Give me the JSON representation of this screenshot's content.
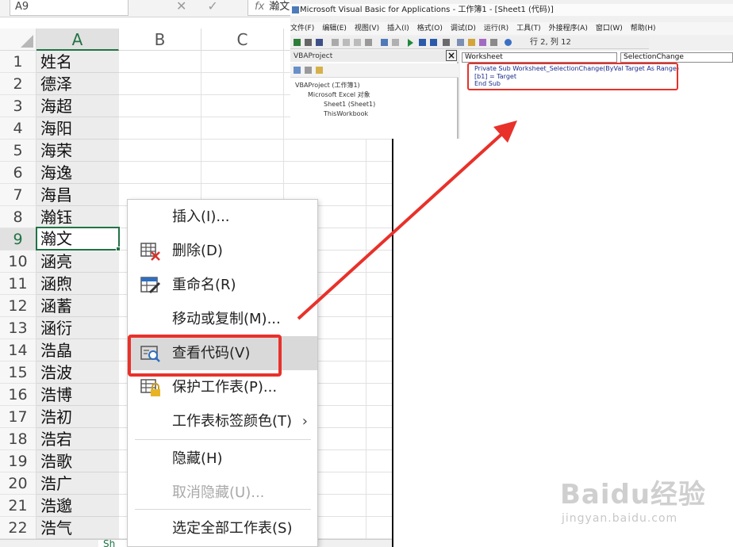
{
  "excel": {
    "name_box": "A9",
    "formula_value": "瀚文",
    "sheet_tab_label": "Sh",
    "column_headers": [
      "A",
      "B",
      "C"
    ],
    "rows": [
      {
        "num": "1",
        "a": "姓名"
      },
      {
        "num": "2",
        "a": "德泽"
      },
      {
        "num": "3",
        "a": "海超"
      },
      {
        "num": "4",
        "a": "海阳"
      },
      {
        "num": "5",
        "a": "海荣"
      },
      {
        "num": "6",
        "a": "海逸"
      },
      {
        "num": "7",
        "a": "海昌"
      },
      {
        "num": "8",
        "a": "瀚钰"
      },
      {
        "num": "9",
        "a": "瀚文"
      },
      {
        "num": "10",
        "a": "涵亮"
      },
      {
        "num": "11",
        "a": "涵煦"
      },
      {
        "num": "12",
        "a": "涵蓄"
      },
      {
        "num": "13",
        "a": "涵衍"
      },
      {
        "num": "14",
        "a": "浩皛"
      },
      {
        "num": "15",
        "a": "浩波"
      },
      {
        "num": "16",
        "a": "浩博"
      },
      {
        "num": "17",
        "a": "浩初"
      },
      {
        "num": "18",
        "a": "浩宕"
      },
      {
        "num": "19",
        "a": "浩歌"
      },
      {
        "num": "20",
        "a": "浩广"
      },
      {
        "num": "21",
        "a": "浩邈"
      },
      {
        "num": "22",
        "a": "浩气"
      }
    ]
  },
  "context_menu": {
    "items": [
      {
        "label": "插入(I)...",
        "icon": ""
      },
      {
        "label": "删除(D)",
        "icon": "delete-sheet-icon"
      },
      {
        "label": "重命名(R)",
        "icon": "rename-sheet-icon"
      },
      {
        "label": "移动或复制(M)...",
        "icon": ""
      },
      {
        "label": "查看代码(V)",
        "icon": "view-code-icon"
      },
      {
        "label": "保护工作表(P)...",
        "icon": "protect-sheet-icon"
      },
      {
        "label": "工作表标签颜色(T)",
        "icon": ""
      },
      {
        "label": "隐藏(H)",
        "icon": ""
      },
      {
        "label": "取消隐藏(U)...",
        "icon": ""
      },
      {
        "label": "选定全部工作表(S)",
        "icon": ""
      }
    ],
    "submenu_arrow": "›"
  },
  "vba": {
    "title": "Microsoft Visual Basic for Applications - 工作簿1 - [Sheet1 (代码)]",
    "menu": [
      "文件(F)",
      "编辑(E)",
      "视图(V)",
      "插入(I)",
      "格式(O)",
      "调试(D)",
      "运行(R)",
      "工具(T)",
      "外接程序(A)",
      "窗口(W)",
      "帮助(H)"
    ],
    "cursor_position": "行 2, 列 12",
    "project_title": "VBAProject",
    "tree": [
      "VBAProject (工作簿1)",
      "Microsoft Excel 对象",
      "Sheet1 (Sheet1)",
      "ThisWorkbook"
    ],
    "object_combo": "Worksheet",
    "procedure_combo": "SelectionChange",
    "code": [
      "Private Sub Worksheet_SelectionChange(ByVal Target As Range)",
      "[b1] = Target",
      "End Sub"
    ]
  },
  "watermark": {
    "brand": "Baidu经验",
    "url": "jingyan.baidu.com"
  },
  "colors": {
    "excel_green": "#217346",
    "highlight_red": "#e8312a"
  }
}
